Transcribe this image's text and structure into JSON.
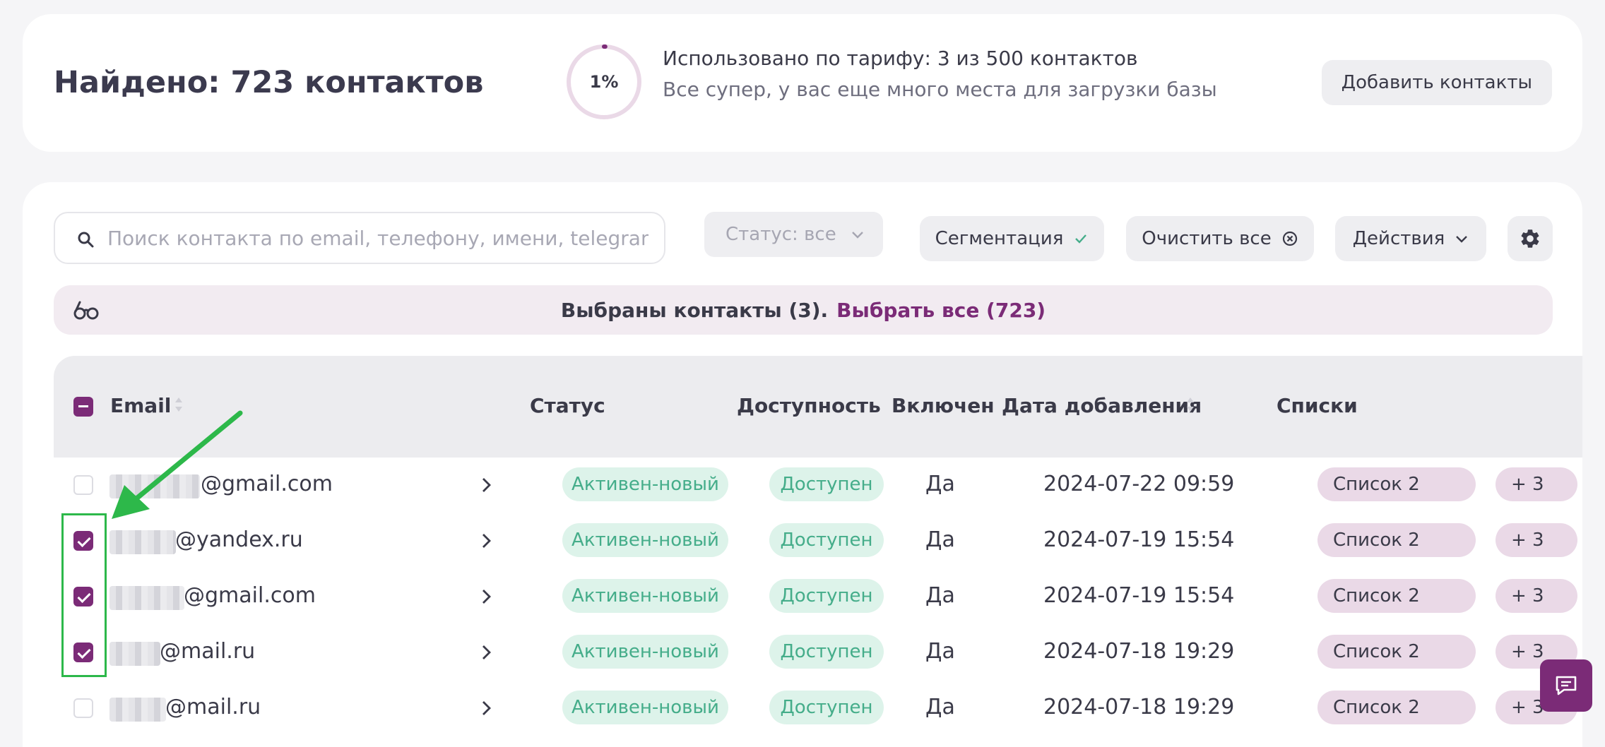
{
  "summary": {
    "found_title": "Найдено: 723 контактов",
    "usage_percent": 0.6,
    "usage_percent_label": "1%",
    "usage_text": "Использовано по тарифу: 3 из 500 контактов",
    "usage_subtext": "Все супер, у вас еще много места для загрузки базы",
    "add_button": "Добавить контакты"
  },
  "toolbar": {
    "search_placeholder": "Поиск контакта по email, телефону, имени, telegram",
    "status_filter": "Статус: все",
    "segmentation_button": "Сегментация",
    "clear_button": "Очистить все",
    "actions_button": "Действия"
  },
  "selection_banner": {
    "text": "Выбраны контакты (3).",
    "select_all_link": "Выбрать все (723)"
  },
  "table": {
    "columns": {
      "email": "Email",
      "status": "Статус",
      "availability": "Доступность",
      "enabled": "Включен",
      "date_added": "Дата добавления",
      "lists": "Списки"
    },
    "rows": [
      {
        "email_suffix": "@gmail.com",
        "checked": false,
        "status": "Активен-новый",
        "availability": "Доступен",
        "enabled": "Да",
        "date": "2024-07-22 09:59",
        "list": "Список 2",
        "more": "+ 3"
      },
      {
        "email_suffix": "@yandex.ru",
        "checked": true,
        "status": "Активен-новый",
        "availability": "Доступен",
        "enabled": "Да",
        "date": "2024-07-19 15:54",
        "list": "Список 2",
        "more": "+ 3"
      },
      {
        "email_suffix": "@gmail.com",
        "checked": true,
        "status": "Активен-новый",
        "availability": "Доступен",
        "enabled": "Да",
        "date": "2024-07-19 15:54",
        "list": "Список 2",
        "more": "+ 3"
      },
      {
        "email_suffix": "@mail.ru",
        "checked": true,
        "status": "Активен-новый",
        "availability": "Доступен",
        "enabled": "Да",
        "date": "2024-07-18 19:29",
        "list": "Список 2",
        "more": "+ 3"
      },
      {
        "email_suffix": "@mail.ru",
        "checked": false,
        "status": "Активен-новый",
        "availability": "Доступен",
        "enabled": "Да",
        "date": "2024-07-18 19:29",
        "list": "Список 2",
        "more": "+ 3"
      }
    ]
  },
  "colors": {
    "brand": "#7b2b77",
    "status_green": "#45ad8a",
    "annotation": "#2db84a"
  },
  "icons": [
    "search-icon",
    "chevron-down-icon",
    "check-icon",
    "close-circle-icon",
    "gear-icon",
    "glasses-icon",
    "sort-icon",
    "chevron-right-icon",
    "chat-icon"
  ]
}
